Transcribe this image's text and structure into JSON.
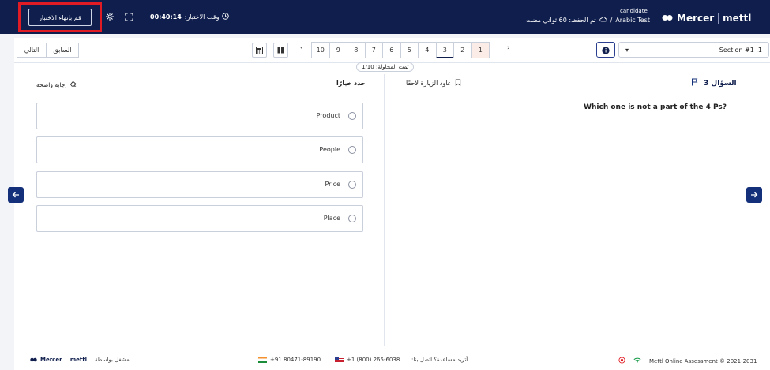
{
  "header": {
    "finish_button": "قم بإنهاء الاختبار",
    "timer_label": "وقت الاختبار:",
    "timer_value": "00:40:14",
    "candidate": "candidate",
    "saved_text": "تم الحفظ: 60 ثواني مضت",
    "test_name": "Arabic Test",
    "brand_mercer": "Mercer",
    "brand_mettl": "mettl"
  },
  "toolbar": {
    "prev_label": "السابق",
    "next_label": "التالي",
    "pages": [
      "10",
      "9",
      "8",
      "7",
      "6",
      "5",
      "4",
      "3",
      "2",
      "1"
    ],
    "current_page": "3",
    "answered_page": "1",
    "section": "Section #1 .1",
    "attempts": "تمت المحاولة: 1/10"
  },
  "question": {
    "title": "السؤال 3",
    "revisit_label": "عاود الزيارة لاحقًا",
    "text": "Which one is not a part of the 4 Ps?",
    "choose_label": "حدد خيارًا",
    "clear_label": "إجابة واضحة",
    "options": [
      "Product",
      "People",
      "Price",
      "Place"
    ]
  },
  "footer": {
    "powered_by": "مشغل بواسطة",
    "brand_mercer": "Mercer",
    "brand_mettl": "mettl",
    "phone_in": "+91 80471-89190",
    "phone_us": "+1 (800) 265-6038",
    "help_text": "أتريد مساعدة؟ اتصل بنا:",
    "copyright": "Mettl Online Assessment © 2021-2031"
  },
  "colors": {
    "header_bg": "#0f1e4d",
    "highlight": "#e01b24",
    "accent": "#14307a"
  }
}
